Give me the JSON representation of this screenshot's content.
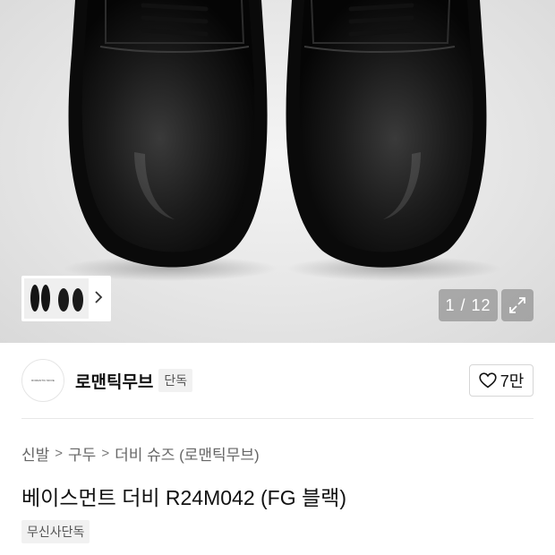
{
  "gallery": {
    "counter": "1 / 12",
    "main_image": "black-leather-derby-shoes-pair",
    "thumbnail": "shoe-thumbnails"
  },
  "brand": {
    "name": "로맨틱무브",
    "badge": "단독",
    "logo_text": "ROMANTIC MOVE"
  },
  "like": {
    "count": "7만",
    "icon": "heart-icon"
  },
  "breadcrumb": {
    "items": [
      "신발",
      "구두",
      "더비 슈즈 (로맨틱무브)"
    ],
    "separator": ">"
  },
  "product": {
    "title": "베이스먼트 더비 R24M042 (FG 블랙)",
    "tag": "무신사단독"
  },
  "colors": {
    "badge_bg": "#f1f1f1",
    "overlay_bg": "#787878"
  }
}
